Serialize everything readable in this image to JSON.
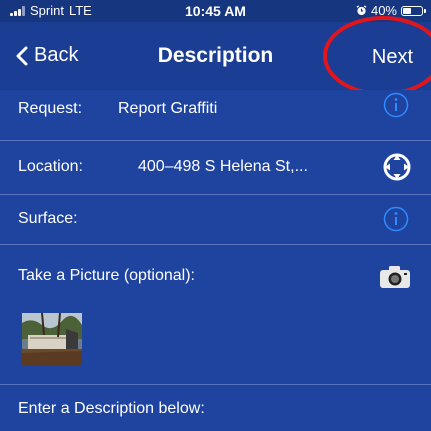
{
  "status_bar": {
    "carrier": "Sprint",
    "network": "LTE",
    "time": "10:45 AM",
    "battery": "40%"
  },
  "nav": {
    "back_label": "Back",
    "title": "Description",
    "next_label": "Next"
  },
  "form": {
    "request_label": "Request:",
    "request_value": "Report Graffiti",
    "location_label": "Location:",
    "location_value": "400–498 S Helena St,...",
    "surface_label": "Surface:",
    "picture_label": "Take a Picture (optional):",
    "description_label": "Enter a Description below:"
  },
  "colors": {
    "background": "#1b3d93",
    "row_background": "#1e44a0",
    "accent_blue": "#2f8bff",
    "highlight_red": "#e0161c"
  },
  "icons": {
    "back": "chevron-left-icon",
    "info": "info-icon",
    "location": "crosshair-icon",
    "camera": "camera-icon",
    "alarm": "alarm-clock-icon",
    "battery": "battery-icon"
  }
}
